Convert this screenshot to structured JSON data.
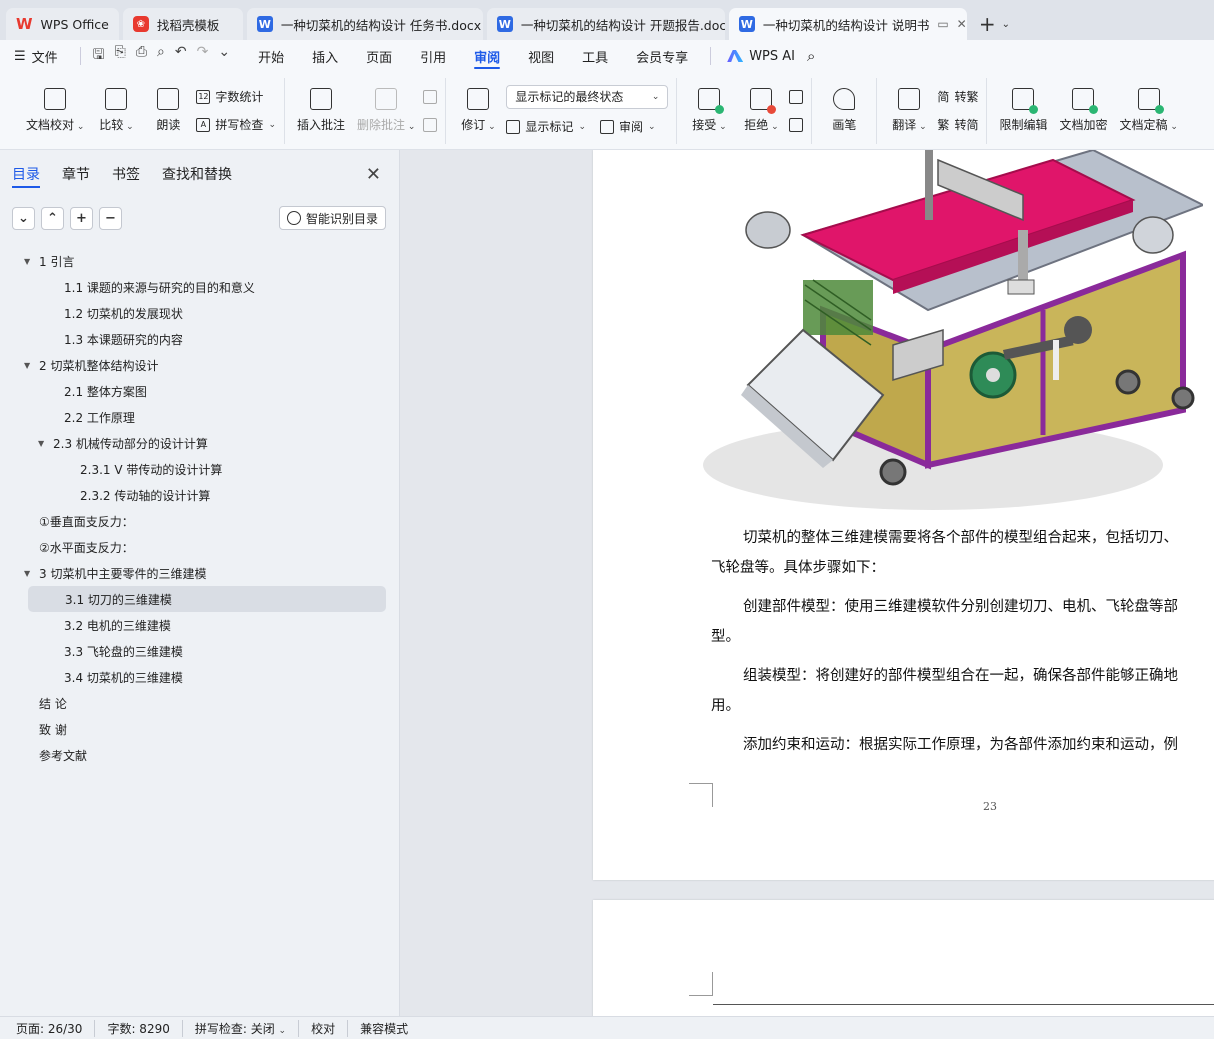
{
  "tabs": [
    {
      "label": "WPS Office",
      "type": "home"
    },
    {
      "label": "找稻壳模板",
      "type": "template"
    },
    {
      "label": "一种切菜机的结构设计 任务书.docx",
      "type": "doc"
    },
    {
      "label": "一种切菜机的结构设计 开题报告.docx",
      "type": "doc"
    },
    {
      "label": "一种切菜机的结构设计 说明书",
      "type": "doc",
      "active": true
    }
  ],
  "menu": {
    "file": "文件",
    "items": [
      "开始",
      "插入",
      "页面",
      "引用",
      "审阅",
      "视图",
      "工具",
      "会员专享"
    ],
    "active": "审阅",
    "wps_ai": "WPS AI"
  },
  "ribbon": {
    "doc_check": "文档校对",
    "compare": "比较",
    "read_aloud": "朗读",
    "word_count": "字数统计",
    "spell_check": "拼写检查",
    "insert_comment": "插入批注",
    "delete_comment": "删除批注",
    "track_changes": "修订",
    "markup_select": "显示标记的最终状态",
    "show_markup": "显示标记",
    "review": "审阅",
    "accept": "接受",
    "reject": "拒绝",
    "pen": "画笔",
    "translate": "翻译",
    "to_traditional": "转繁",
    "to_simplified": "转简",
    "restrict_edit": "限制编辑",
    "encrypt": "文档加密",
    "finalize": "文档定稿"
  },
  "nav": {
    "tabs": [
      "目录",
      "章节",
      "书签",
      "查找和替换"
    ],
    "smart_toc": "智能识别目录",
    "toc": [
      {
        "text": "1  引言",
        "level": 1,
        "expand": true
      },
      {
        "text": "1.1  课题的来源与研究的目的和意义",
        "level": 2
      },
      {
        "text": "1.2  切菜机的发展现状",
        "level": 2
      },
      {
        "text": "1.3  本课题研究的内容",
        "level": 2
      },
      {
        "text": "2  切菜机整体结构设计",
        "level": 1,
        "expand": true
      },
      {
        "text": "2.1  整体方案图",
        "level": 2
      },
      {
        "text": "2.2  工作原理",
        "level": 2
      },
      {
        "text": "2.3  机械传动部分的设计计算",
        "level": 2,
        "expand": true
      },
      {
        "text": "2.3.1 V 带传动的设计计算",
        "level": 3
      },
      {
        "text": "2.3.2 传动轴的设计计算",
        "level": 3
      },
      {
        "text": "①垂直面支反力：",
        "level": 1
      },
      {
        "text": "②水平面支反力：",
        "level": 1
      },
      {
        "text": "3  切菜机中主要零件的三维建模",
        "level": 1,
        "expand": true
      },
      {
        "text": "3.1 切刀的三维建模",
        "level": 2,
        "selected": true
      },
      {
        "text": "3.2  电机的三维建模",
        "level": 2
      },
      {
        "text": "3.3 飞轮盘的三维建模",
        "level": 2
      },
      {
        "text": "3.4 切菜机的三维建模",
        "level": 2
      },
      {
        "text": "结    论",
        "level": 1
      },
      {
        "text": "致    谢",
        "level": 1
      },
      {
        "text": "参考文献",
        "level": 1
      }
    ]
  },
  "document": {
    "paragraphs": [
      "切菜机的整体三维建模需要将各个部件的模型组合起来，包括切刀、",
      "飞轮盘等。具体步骤如下：",
      "创建部件模型：使用三维建模软件分别创建切刀、电机、飞轮盘等部",
      "型。",
      "组装模型：将创建好的部件模型组合在一起，确保各部件能够正确地",
      "用。",
      "添加约束和运动：根据实际工作原理，为各部件添加约束和运动，例"
    ],
    "page_number": "23"
  },
  "status": {
    "page": "页面: 26/30",
    "words": "字数: 8290",
    "spell": "拼写检查: 关闭",
    "proof": "校对",
    "compat": "兼容模式"
  },
  "colors": {
    "accent": "#1e5ae8",
    "conveyor": "#e0156a",
    "frame": "#8a2a9a",
    "cabinet": "#c9b55a"
  }
}
